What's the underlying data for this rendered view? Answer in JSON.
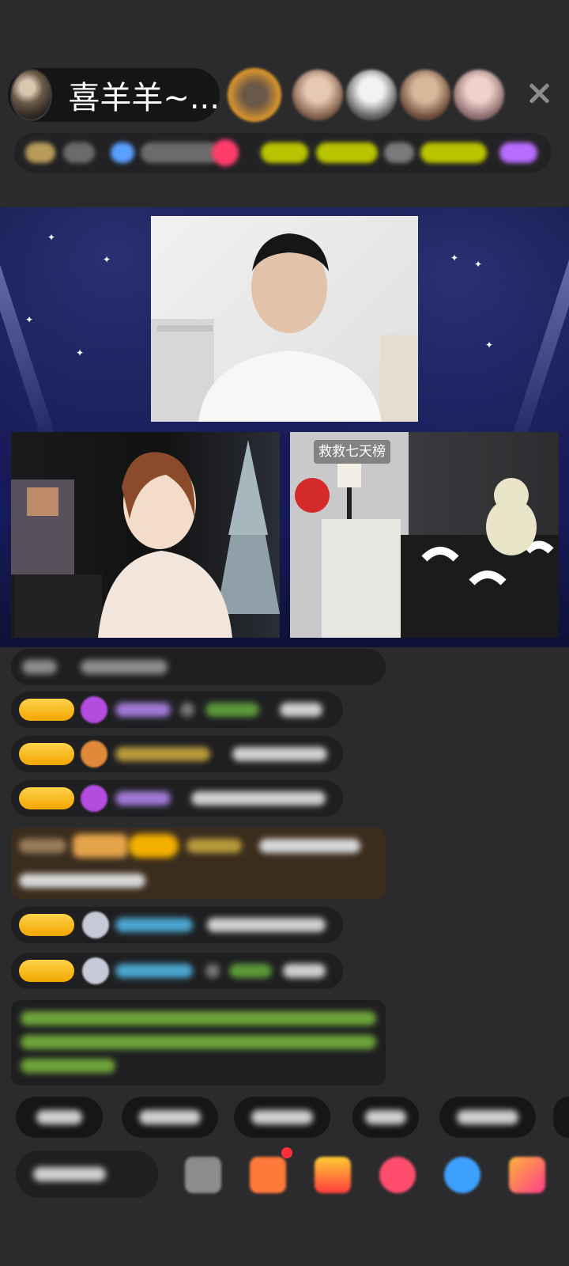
{
  "host": {
    "name": "喜羊羊~..."
  },
  "cams": {
    "right_tag": "救救七天榜"
  },
  "colors": {
    "background": "#2b2b2d",
    "stage": "#161b5a",
    "badge_gold": "#f2a600",
    "notice_green": "#6ea43a"
  },
  "icons": [
    "host-avatar",
    "viewer-avatar",
    "close-icon",
    "gem-icon",
    "gift-icon",
    "fan-icon",
    "game-icon",
    "more-icon"
  ]
}
